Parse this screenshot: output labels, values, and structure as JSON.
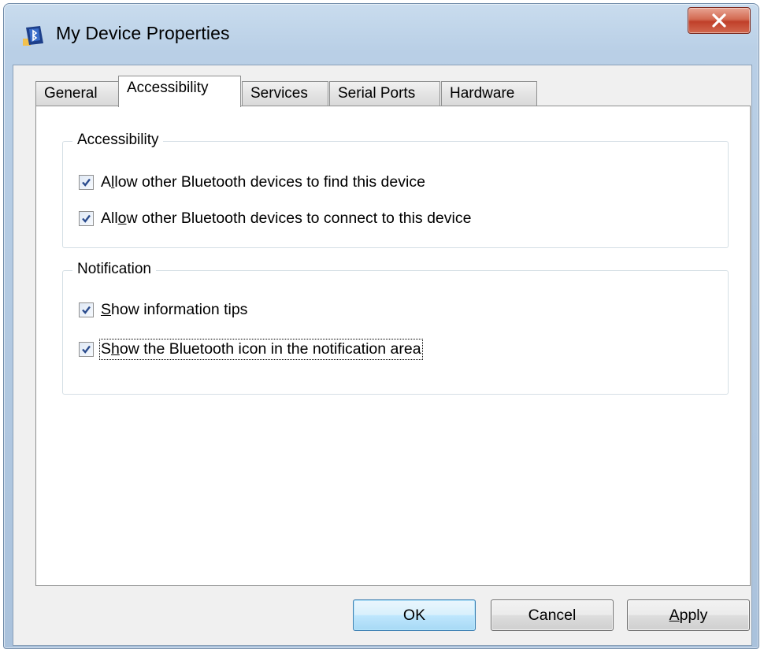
{
  "window": {
    "title": "My Device Properties"
  },
  "tabs": [
    {
      "label": "General",
      "active": false
    },
    {
      "label": "Accessibility",
      "active": true
    },
    {
      "label": "Services",
      "active": false
    },
    {
      "label": "Serial Ports",
      "active": false
    },
    {
      "label": "Hardware",
      "active": false
    }
  ],
  "accessibility_group": {
    "label": "Accessibility",
    "options": [
      {
        "pre": "A",
        "key": "l",
        "post": "low other Bluetooth devices to find this device",
        "checked": true
      },
      {
        "pre": "All",
        "key": "o",
        "post": "w other Bluetooth devices to connect to this device",
        "checked": true
      }
    ]
  },
  "notification_group": {
    "label": "Notification",
    "options": [
      {
        "pre": "",
        "key": "S",
        "post": "how information tips",
        "checked": true
      },
      {
        "pre": "S",
        "key": "h",
        "post": "ow the Bluetooth icon in the notification area",
        "checked": true,
        "focused": true
      }
    ]
  },
  "buttons": {
    "ok": {
      "pre": "",
      "key": "",
      "post": "OK"
    },
    "cancel": {
      "pre": "",
      "key": "",
      "post": "Cancel"
    },
    "apply": {
      "pre": "",
      "key": "A",
      "post": "pply"
    }
  },
  "colors": {
    "title_bar": "#b9cfe6",
    "close_button": "#c0402a",
    "default_button": "#bee6fd",
    "checkmark": "#2a4b8d"
  },
  "icons": {
    "app": "bluetooth-device-icon",
    "close": "close-icon",
    "check": "checkmark-icon"
  }
}
